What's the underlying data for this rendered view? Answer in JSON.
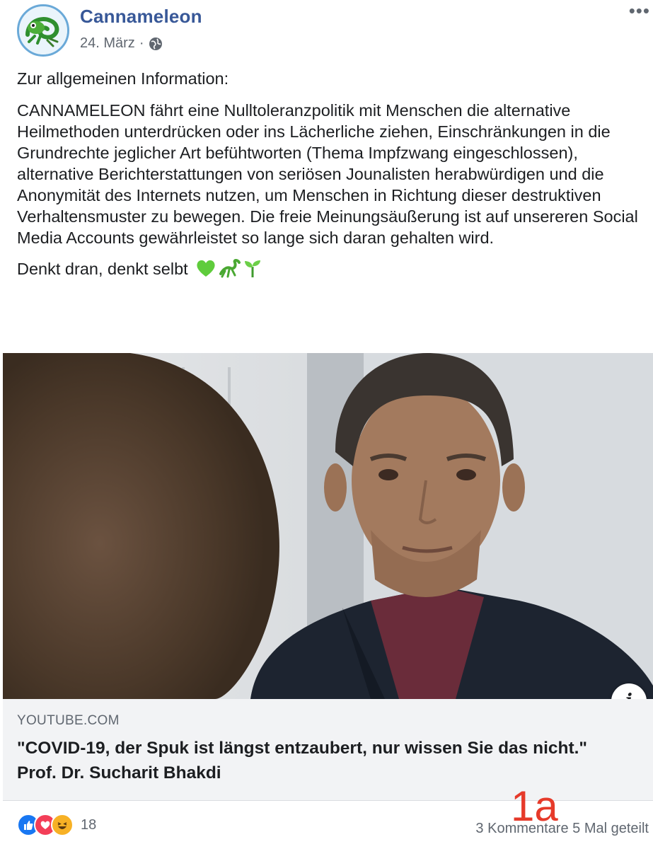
{
  "post": {
    "page_name": "Cannameleon",
    "date": "24. März",
    "separator": "·",
    "more_label": "•••",
    "paragraphs": [
      "Zur allgemeinen Information:",
      "CANNAMELEON fährt eine Nulltoleranzpolitik mit Menschen die alternative Heilmethoden unterdrücken oder ins Lächerliche ziehen, Einschränkungen in die Grundrechte jeglicher Art befühtworten (Thema Impfzwang eingeschlossen), alternative Berichterstattungen von seriösen Jounalisten herabwürdigen und die Anonymität des Internets nutzen, um Menschen in Richtung dieser destruktiven Verhaltensmuster zu bewegen. Die freie Meinungsäußerung ist auf unsereren Social Media Accounts gewährleistet so lange sich daran gehalten wird.",
      "Denkt dran, denkt selbt"
    ],
    "emojis": [
      "green-heart-icon",
      "lizard-icon",
      "seedling-icon"
    ]
  },
  "link": {
    "domain": "YOUTUBE.COM",
    "title": "\"COVID-19, der Spuk ist längst entzaubert, nur wissen Sie das nicht.\" Prof. Dr. Sucharit Bhakdi",
    "info_label": "i"
  },
  "footer": {
    "reaction_count": "18",
    "comments": "3 Kommentare",
    "shares": "5 Mal geteilt",
    "stats_sep": " "
  },
  "overlay": {
    "label": "1a"
  },
  "colors": {
    "page_name": "#385898",
    "meta": "#606770",
    "like": "#1877f2",
    "love": "#f33e58",
    "haha": "#f7b125",
    "overlay": "#e63a2a"
  }
}
